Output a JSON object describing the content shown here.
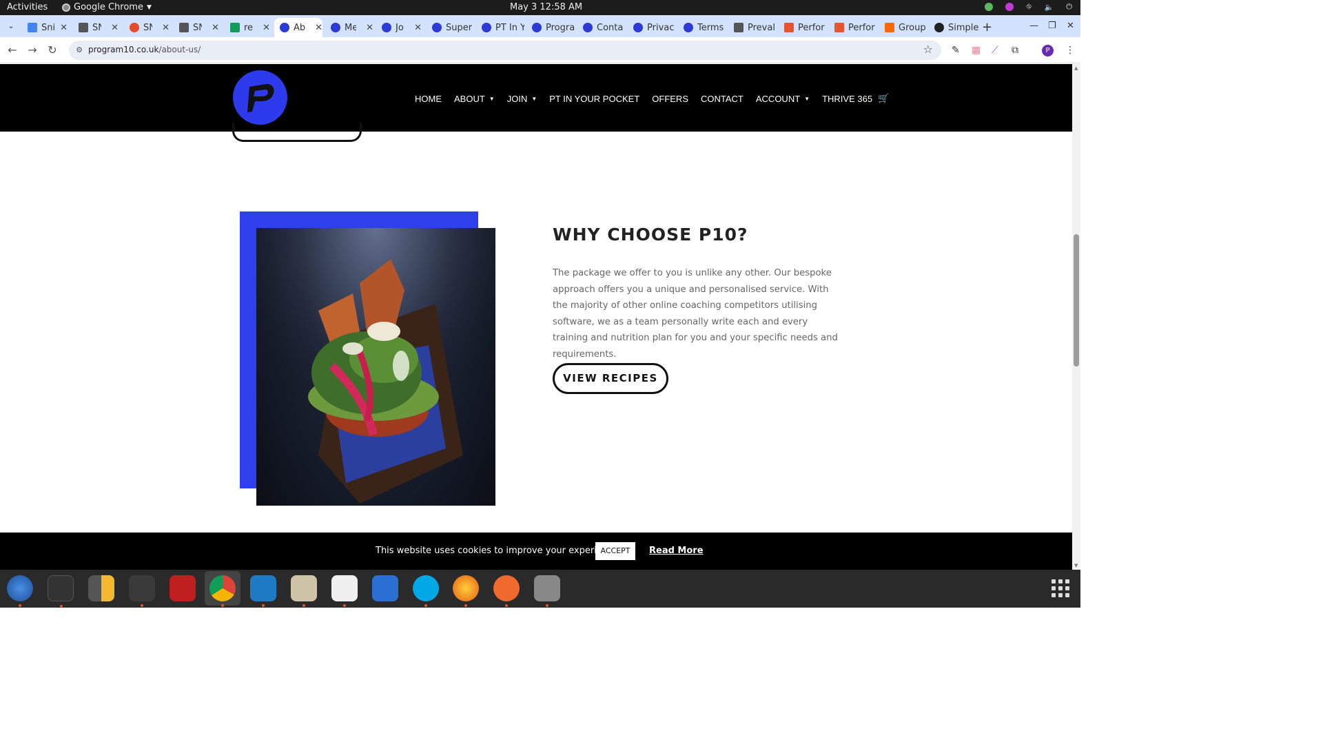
{
  "os_bar": {
    "activities": "Activities",
    "app_name": "Google Chrome",
    "clock": "May 3  12:58 AM"
  },
  "tabs": [
    {
      "title": "Sni",
      "icon": "docs-icon"
    },
    {
      "title": "SN",
      "icon": "snp-icon"
    },
    {
      "title": "SN",
      "icon": "ordino-icon"
    },
    {
      "title": "SN",
      "icon": "snp-icon"
    },
    {
      "title": "ref",
      "icon": "sheets-icon"
    },
    {
      "title": "Ab",
      "icon": "program10-icon"
    },
    {
      "title": "Me",
      "icon": "program10-icon"
    },
    {
      "title": "Joi",
      "icon": "program10-icon"
    },
    {
      "title": "Super",
      "icon": "program10-icon"
    },
    {
      "title": "PT In Y",
      "icon": "program10-icon"
    },
    {
      "title": "Progra",
      "icon": "program10-icon"
    },
    {
      "title": "Conta",
      "icon": "program10-icon"
    },
    {
      "title": "Privac",
      "icon": "program10-icon"
    },
    {
      "title": "Terms",
      "icon": "program10-icon"
    },
    {
      "title": "Preval",
      "icon": "page-icon"
    },
    {
      "title": "Perfor",
      "icon": "perf-icon"
    },
    {
      "title": "Perfor",
      "icon": "perf-icon"
    },
    {
      "title": "Group",
      "icon": "zapier-icon"
    },
    {
      "title": "Simple",
      "icon": "github-icon"
    }
  ],
  "address_bar": {
    "domain": "program10.co.uk",
    "path": "/about-us/"
  },
  "site": {
    "nav": [
      "HOME",
      "ABOUT",
      "JOIN",
      "PT IN YOUR POCKET",
      "OFFERS",
      "CONTACT",
      "ACCOUNT",
      "THRIVE 365"
    ],
    "section": {
      "heading": "WHY CHOOSE P10?",
      "body": "The package we offer to you is unlike any other. Our bespoke approach offers you a unique and personalised service. With the majority of other online coaching competitors utilising software, we as a team personally write each and every training and nutrition plan for you and your specific needs and requirements.",
      "cta": "VIEW RECIPES"
    },
    "cookie": {
      "message": "This website uses cookies to improve your experience.",
      "accept": "ACCEPT",
      "read_more": "Read More"
    }
  },
  "colors": {
    "brand_blue": "#2d40ec",
    "header_bg": "#000000",
    "tab_strip": "#d3e3fd"
  },
  "dock_apps": [
    "thunderbird",
    "terminal",
    "calculator",
    "system-monitor",
    "filezilla",
    "chrome",
    "vscode",
    "files",
    "text-editor",
    "libreoffice-writer",
    "skype",
    "firefox-style",
    "pen-app",
    "disks"
  ]
}
